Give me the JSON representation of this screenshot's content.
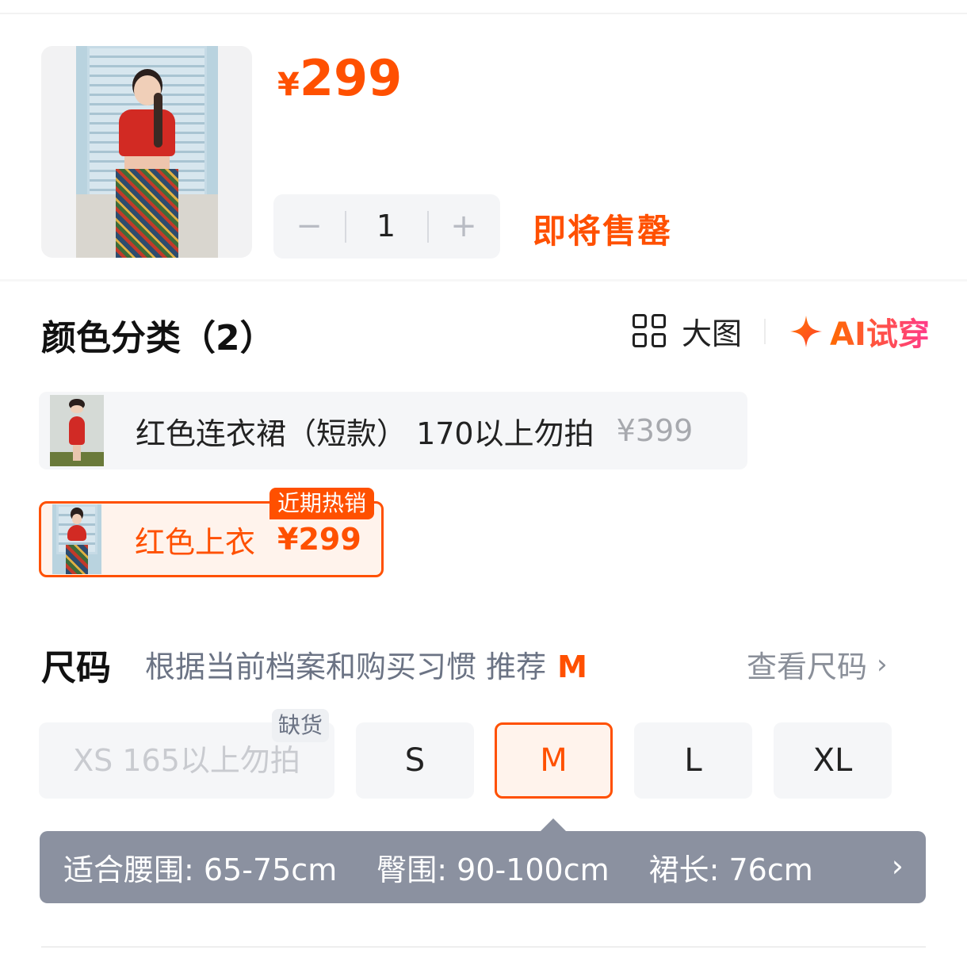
{
  "product": {
    "price_currency": "¥",
    "price_value": "299",
    "quantity": "1",
    "minus_symbol": "−",
    "plus_symbol": "+",
    "stock_status": "即将售罄"
  },
  "color_section": {
    "title": "颜色分类（2）",
    "big_image_label": "大图",
    "ai_try_label": "AI试穿",
    "options": [
      {
        "name": "红色连衣裙（短款） 170以上勿拍",
        "price": "¥399",
        "selected": false
      },
      {
        "name": "红色上衣",
        "price": "¥299",
        "selected": true,
        "badge": "近期热销"
      }
    ]
  },
  "size_section": {
    "title": "尺码",
    "hint": "根据当前档案和购买习惯 推荐",
    "recommended": "M",
    "size_chart_link": "查看尺码",
    "chevron": "›",
    "sizes": [
      {
        "label": "XS 165以上勿拍",
        "state": "out_of_stock",
        "badge": "缺货"
      },
      {
        "label": "S",
        "state": "available"
      },
      {
        "label": "M",
        "state": "selected"
      },
      {
        "label": "L",
        "state": "available"
      },
      {
        "label": "XL",
        "state": "available"
      }
    ],
    "fit_tip": {
      "waist": "适合腰围: 65-75cm",
      "hip": "臀围: 90-100cm",
      "length": "裙长: 76cm",
      "chevron": "›"
    }
  },
  "colors": {
    "accent": "#ff5000",
    "tooltip_bg": "#8b91a0",
    "chip_bg": "#f5f6f8"
  }
}
